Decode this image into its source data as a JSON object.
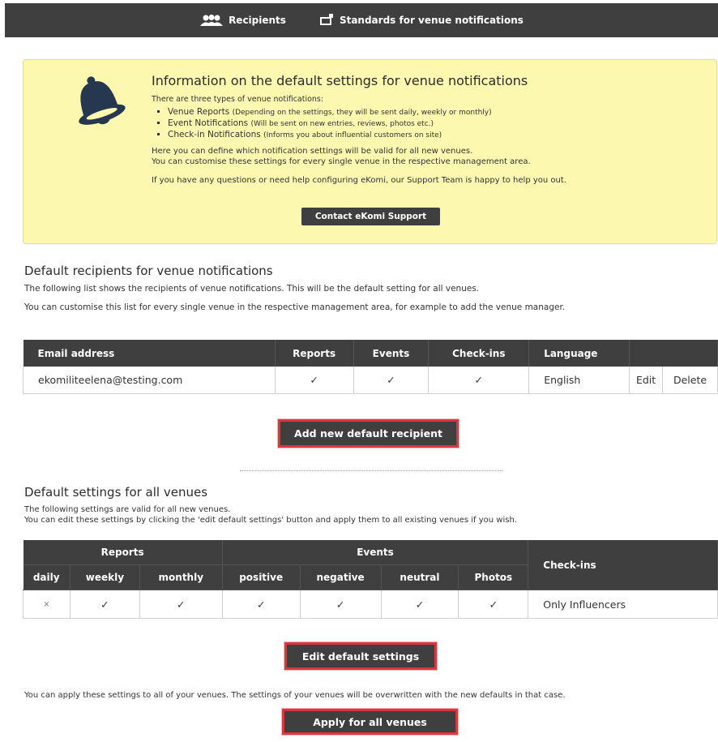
{
  "topnav": {
    "recipients_label": "Recipients",
    "standards_label": "Standards for venue notifications"
  },
  "info": {
    "title": "Information on the default settings for venue notifications",
    "intro": "There are three types of venue notifications:",
    "items": [
      {
        "name": "Venue Reports",
        "note": "(Depending on the settings, they will be sent daily, weekly or monthly)"
      },
      {
        "name": "Event Notifications",
        "note": "(Will be sent on new entries, reviews, photos etc.)"
      },
      {
        "name": "Check-in Notifications",
        "note": "(Informs you about influential customers on site)"
      }
    ],
    "paragraph1_line1": "Here you can define which notification settings will be valid for all new venues.",
    "paragraph1_line2": "You can customise these settings for every single venue in the respective management area.",
    "paragraph2": "If you have any questions or need help configuring eKomi, our Support Team is happy to help you out.",
    "contact_button": "Contact eKomi Support",
    "bell_icon": "bell-icon"
  },
  "recipients": {
    "title": "Default recipients for venue notifications",
    "line1": "The following list shows the recipients of venue notifications. This will be the default setting for all venues.",
    "line2": "You can customise this list for every single venue in the respective management area, for example to add the venue manager.",
    "columns": [
      "Email address",
      "Reports",
      "Events",
      "Check-ins",
      "Language"
    ],
    "rows": [
      {
        "email": "ekomiliteelena@testing.com",
        "reports": "✓",
        "events": "✓",
        "checkins": "✓",
        "language": "English",
        "edit": "Edit",
        "delete": "Delete"
      }
    ],
    "add_button": "Add new default recipient"
  },
  "settings": {
    "title": "Default settings for all venues",
    "line1": "The following settings are valid for all new venues.",
    "line2": "You can edit these settings by clicking the 'edit default settings' button and apply them to all existing venues if you wish.",
    "group_headers": [
      "Reports",
      "Events",
      "Check-ins"
    ],
    "sub_headers": [
      "daily",
      "weekly",
      "monthly",
      "positive",
      "negative",
      "neutral",
      "Photos"
    ],
    "row": [
      "×",
      "✓",
      "✓",
      "✓",
      "✓",
      "✓",
      "✓",
      "Only Influencers"
    ],
    "edit_button": "Edit default settings",
    "apply_text": "You can apply these settings to all of your venues. The settings of your venues will be overwritten with the new defaults in that case.",
    "apply_button": "Apply for all venues"
  },
  "colors": {
    "topbar": "#3f3f3f",
    "info_background": "#fcf8b0",
    "highlight_border": "#d9363e",
    "bell": "#253850"
  }
}
